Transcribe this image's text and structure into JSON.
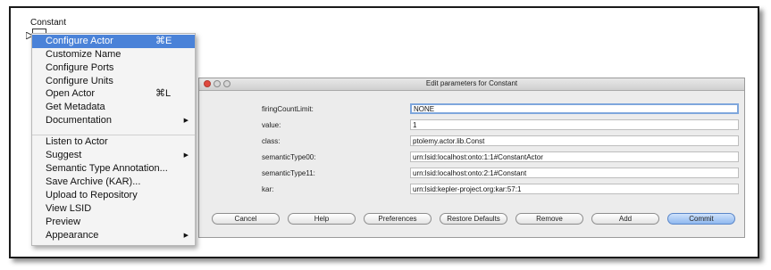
{
  "canvas": {
    "actor_label": "Constant"
  },
  "menu": {
    "items": [
      {
        "label": "Configure Actor",
        "shortcut": "⌘E",
        "selected": true
      },
      {
        "label": "Customize Name"
      },
      {
        "label": "Configure Ports"
      },
      {
        "label": "Configure Units"
      },
      {
        "label": "Open Actor",
        "shortcut": "⌘L"
      },
      {
        "label": "Get Metadata"
      },
      {
        "label": "Documentation",
        "submenu": true
      },
      {
        "label": "Listen to Actor"
      },
      {
        "label": "Suggest",
        "submenu": true
      },
      {
        "label": "Semantic Type Annotation..."
      },
      {
        "label": "Save Archive (KAR)..."
      },
      {
        "label": "Upload to Repository"
      },
      {
        "label": "View LSID"
      },
      {
        "label": "Preview"
      },
      {
        "label": "Appearance",
        "submenu": true
      }
    ],
    "submenu_glyph": "▶"
  },
  "dialog": {
    "title": "Edit parameters for Constant",
    "params": [
      {
        "label": "firingCountLimit:",
        "value": "NONE",
        "focused": true
      },
      {
        "label": "value:",
        "value": "1"
      },
      {
        "label": "class:",
        "value": "ptolemy.actor.lib.Const"
      },
      {
        "label": "semanticType00:",
        "value": "urn:lsid:localhost:onto:1:1#ConstantActor"
      },
      {
        "label": "semanticType11:",
        "value": "urn:lsid:localhost:onto:2:1#Constant"
      },
      {
        "label": "kar:",
        "value": "urn:lsid:kepler-project.org:kar:57:1"
      }
    ],
    "buttons": [
      "Cancel",
      "Help",
      "Preferences",
      "Restore Defaults",
      "Remove",
      "Add",
      "Commit"
    ]
  }
}
